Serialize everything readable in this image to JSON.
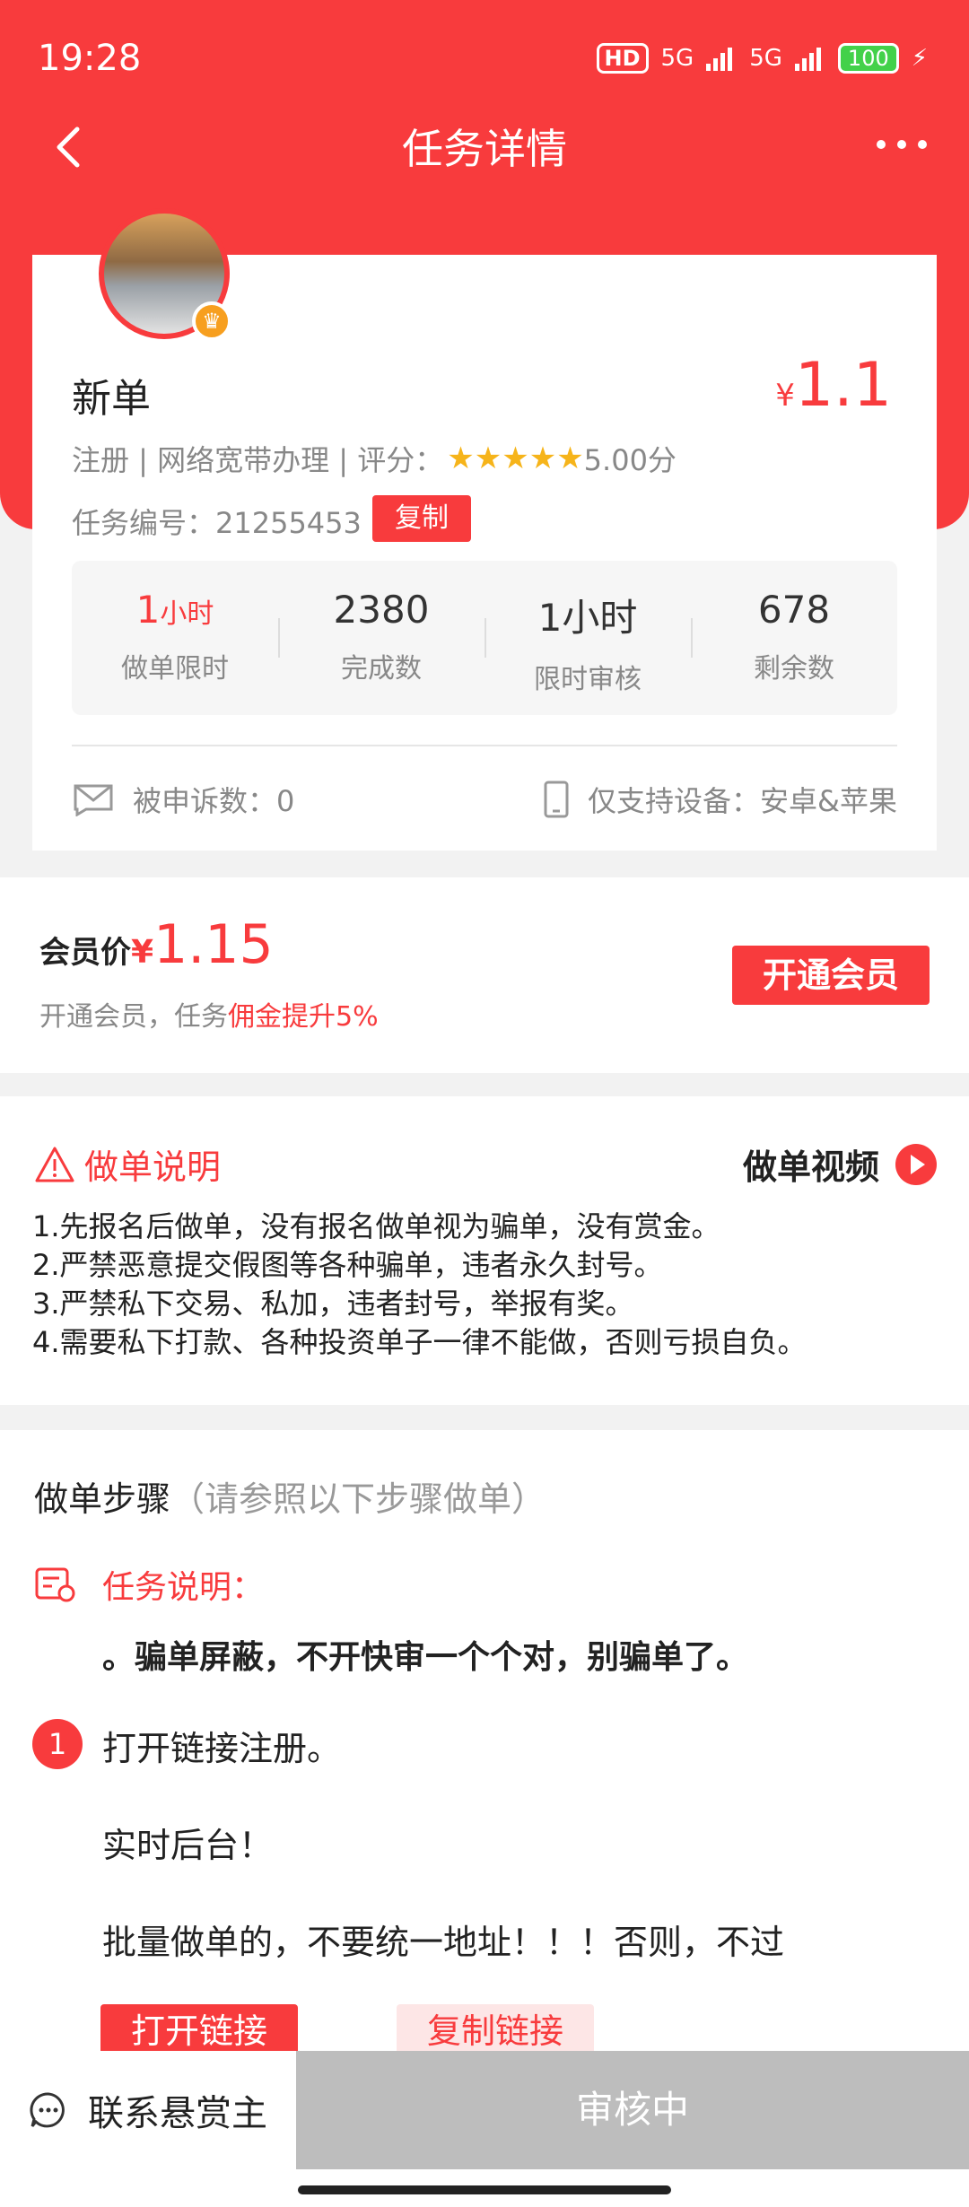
{
  "status_bar": {
    "time": "19:28",
    "hd": "HD",
    "net1": "5G",
    "net2": "5G",
    "battery": "100"
  },
  "nav": {
    "title": "任务详情"
  },
  "task": {
    "name": "新单",
    "price_currency": "¥",
    "price": "1.1",
    "meta": "注册 | 网络宽带办理 | 评分：",
    "stars": "★★★★★",
    "score": "5.00分",
    "id_text": "任务编号：21255453",
    "copy_label": "复制",
    "stats": [
      {
        "value": "1",
        "unit": "小时",
        "label": "做单限时"
      },
      {
        "value": "2380",
        "unit": "",
        "label": "完成数"
      },
      {
        "value": "1小时",
        "unit": "",
        "label": "限时审核"
      },
      {
        "value": "678",
        "unit": "",
        "label": "剩余数"
      }
    ],
    "complaints": "被申诉数：0",
    "devices": "仅支持设备：安卓&苹果"
  },
  "member": {
    "label": "会员价",
    "currency": "¥",
    "price": "1.15",
    "sub_prefix": "开通会员，任务",
    "sub_highlight": "佣金提升5%",
    "button": "开通会员"
  },
  "rules": {
    "title": "做单说明",
    "video": "做单视频",
    "items": [
      "1.先报名后做单，没有报名做单视为骗单，没有赏金。",
      "2.严禁恶意提交假图等各种骗单，违者永久封号。",
      "3.严禁私下交易、私加，违者封号，举报有奖。",
      "4.需要私下打款、各种投资单子一律不能做，否则亏损自负。"
    ]
  },
  "steps": {
    "heading": "做单步骤",
    "heading_hint": "（请参照以下步骤做单）",
    "desc_title": "任务说明：",
    "desc_text": "。骗单屏蔽，不开快审一个个对，别骗单了。",
    "step1_num": "1",
    "step1_text": "打开链接注册。",
    "line2": "实时后台！",
    "line3": "批量做单的，不要统一地址！！！否则，不过",
    "open_link": "打开链接",
    "copy_link": "复制链接"
  },
  "bottom": {
    "contact": "联系悬赏主",
    "status": "审核中"
  },
  "colors": {
    "primary": "#f83b3d",
    "star": "#f6b41a",
    "disabled": "#bdbdbd"
  }
}
